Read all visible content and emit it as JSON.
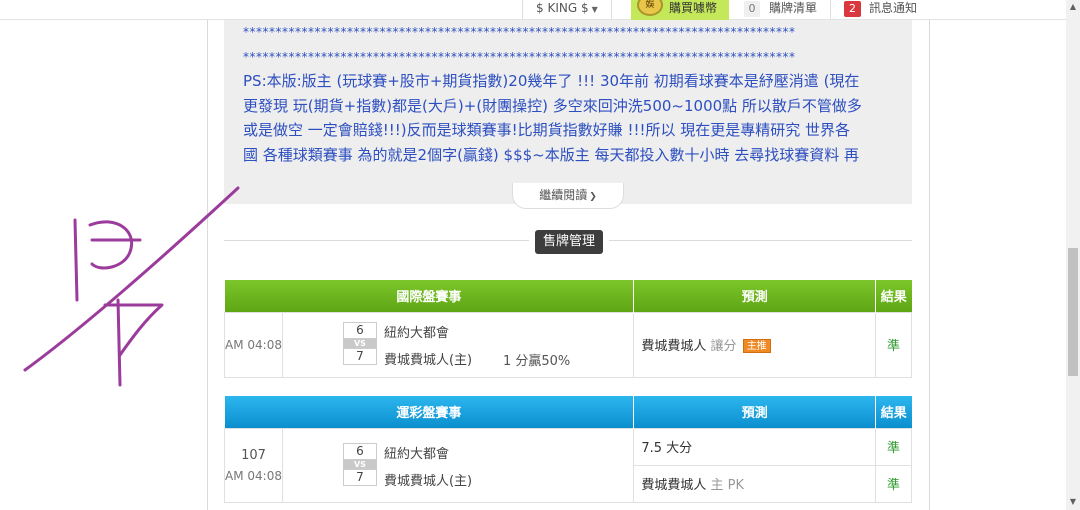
{
  "topbar": {
    "user_label": "$ KING $",
    "coin_badge": "娛",
    "buy_coin_label": "購買噱幣",
    "cart_count": "0",
    "cart_label": "購牌清單",
    "notify_count": "2",
    "notify_label": "訊息通知"
  },
  "intro": {
    "stars_line_1": "*************************************************************************************",
    "stars_line_2": "*************************************************************************************",
    "text_line_1": "PS:本版:版主 (玩球賽+股市+期貨指數)20幾年了 !!! 30年前 初期看球賽本是紓壓消遣 (現在",
    "text_line_2": "更發現 玩(期貨+指數)都是(大戶)+(財團操控) 多空來回沖洗500~1000點 所以散戶不管做多",
    "text_line_3": "或是做空 一定會賠錢!!!)反而是球類賽事!比期貨指數好賺 !!!所以 現在更是專精研究 世界各",
    "text_line_4": "國 各種球類賽事 為的就是2個字(贏錢) $$$~本版主 每天都投入數十小時 去尋找球賽資料 再",
    "read_more": "繼續閱讀"
  },
  "section_title": "售牌管理",
  "table1": {
    "header_event": "國際盤賽事",
    "header_prediction": "預測",
    "header_result": "結果",
    "rows": [
      {
        "time": "AM 04:08",
        "away_score": "6",
        "vs": "VS",
        "home_score": "7",
        "away_team": "紐約大都會",
        "home_team": "費城費城人(主)",
        "handicap": "1 分贏50%",
        "prediction": "費城費城人",
        "prediction_sub": "讓分",
        "tag": "主推",
        "result": "準"
      }
    ]
  },
  "table2": {
    "header_event": "運彩盤賽事",
    "header_prediction": "預測",
    "header_result": "結果",
    "game_no": "107",
    "time": "AM 04:08",
    "away_score": "6",
    "vs": "VS",
    "home_score": "7",
    "away_team": "紐約大都會",
    "home_team": "費城費城人(主)",
    "predictions": [
      {
        "main": "7.5 大分",
        "sub": "",
        "result": "準"
      },
      {
        "main": "費城費城人",
        "sub": "主 PK",
        "result": "準"
      }
    ]
  },
  "colors": {
    "intro_text": "#2d4fc0",
    "green_header": "#6bb61e",
    "blue_header": "#1aa3e0",
    "result_green": "#2e9a2e",
    "tag_orange": "#f08a24",
    "scribble_purple": "#9b3b9b"
  }
}
